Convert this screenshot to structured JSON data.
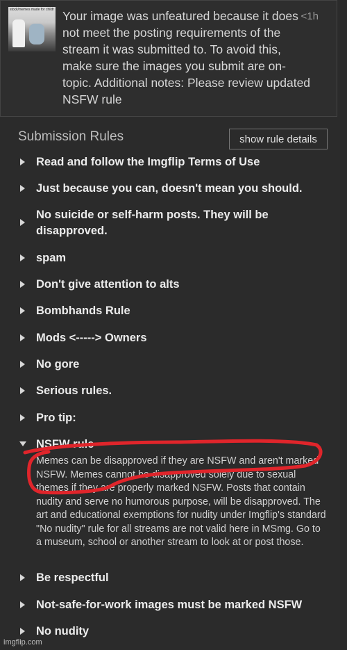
{
  "notification": {
    "thumbnail_caption": "stock/memes made for children",
    "message": "Your image was unfeatured because it does not meet the posting requirements of the stream it was submitted to. To avoid this, make sure the images you submit are on-topic. Additional notes: Please review updated NSFW rule",
    "time": "<1h"
  },
  "rules_section": {
    "title": "Submission Rules",
    "details_button": "show rule details"
  },
  "rules": [
    {
      "label": "Read and follow the Imgflip Terms of Use",
      "expanded": false
    },
    {
      "label": "Just because you can, doesn't mean you should.",
      "expanded": false
    },
    {
      "label": "No suicide or self-harm posts. They will be disapproved.",
      "expanded": false
    },
    {
      "label": "spam",
      "expanded": false
    },
    {
      "label": "Don't give attention to alts",
      "expanded": false
    },
    {
      "label": "Bombhands Rule",
      "expanded": false
    },
    {
      "label": "Mods <-----> Owners",
      "expanded": false
    },
    {
      "label": "No gore",
      "expanded": false
    },
    {
      "label": "Serious rules.",
      "expanded": false
    },
    {
      "label": "Pro tip:",
      "expanded": false
    },
    {
      "label": "NSFW rule",
      "expanded": true,
      "description": "Memes can be disapproved if they are NSFW and aren't marked NSFW. Memes cannot be disapproved solely due to sexual themes if they are properly marked NSFW. Posts that contain nudity and serve no humorous purpose, will be disapproved. The art and educational exemptions for nudity under Imgflip's standard \"No nudity\" rule for all streams are not valid here in MSmg. Go to a museum, school or another stream to look at or post those."
    },
    {
      "label": "Be respectful",
      "expanded": false
    },
    {
      "label": "Not-safe-for-work images must be marked NSFW",
      "expanded": false
    },
    {
      "label": "No nudity",
      "expanded": false
    }
  ],
  "annotation_color": "#e0252b",
  "watermark": "imgflip.com"
}
